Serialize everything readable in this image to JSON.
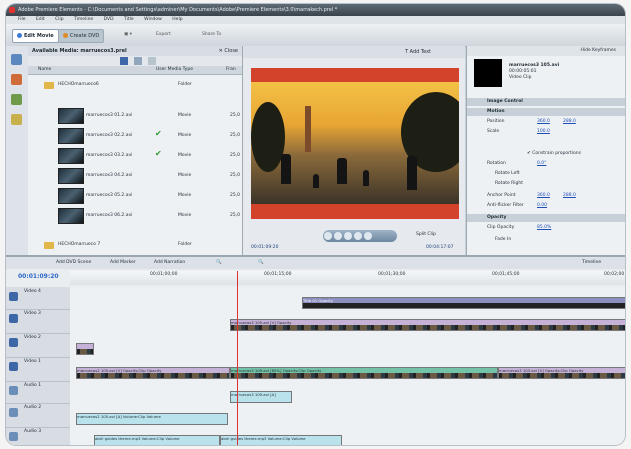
{
  "window": {
    "title": "Adobe Premiere Elements - C:\\Documents and Settings\\adminer\\My Documents\\Adobe\\Premiere Elements\\3.0\\marrakech.prel *"
  },
  "menu": [
    "File",
    "Edit",
    "Clip",
    "Timeline",
    "DVD",
    "Title",
    "Window",
    "Help"
  ],
  "toolbar": {
    "edit_movie": "Edit Movie",
    "create": "Create DVD",
    "export": "Export",
    "share": "Share To"
  },
  "media_panel": {
    "title": "Available Media: marruecos3.prel",
    "close": "Close",
    "columns": {
      "name": "Name",
      "type": "User Media Type",
      "frame": "Fran"
    },
    "items": [
      {
        "name": "HECHOmarrueco6",
        "type": "Folder",
        "frame": "",
        "check": false,
        "folder": true
      },
      {
        "name": "marruecos3 01.2.avi",
        "type": "Movie",
        "frame": "25,0",
        "check": false,
        "folder": false
      },
      {
        "name": "marruecos3 02.2.avi",
        "type": "Movie",
        "frame": "25,0",
        "check": true,
        "folder": false
      },
      {
        "name": "marruecos3 03.2.avi",
        "type": "Movie",
        "frame": "25,0",
        "check": true,
        "folder": false
      },
      {
        "name": "marruecos3 04.2.avi",
        "type": "Movie",
        "frame": "25,0",
        "check": false,
        "folder": false
      },
      {
        "name": "marruecos3 05.2.avi",
        "type": "Movie",
        "frame": "25,0",
        "check": false,
        "folder": false
      },
      {
        "name": "marruecos3 06.2.avi",
        "type": "Movie",
        "frame": "25,0",
        "check": false,
        "folder": false
      },
      {
        "name": "HECHOmarrueco 7",
        "type": "Folder",
        "frame": "",
        "check": false,
        "folder": true
      }
    ]
  },
  "monitor": {
    "add_text": "Add Text",
    "timecode_left": "00:01:09:20",
    "timecode_right": "00:04:17:07",
    "split_clip": "Split Clip"
  },
  "properties": {
    "header": "Hide Keyframes",
    "clip_name": "marruecos3 105.avi",
    "clip_time": "00:00:05:01",
    "clip_kind": "Video Clip",
    "sections": {
      "image_control": "Image Control",
      "motion": "Motion",
      "opacity": "Opacity"
    },
    "rows": {
      "position": {
        "label": "Position",
        "v1": "360.0",
        "v2": "288.0"
      },
      "scale": {
        "label": "Scale",
        "v1": "100.0"
      },
      "constrain": "Constrain proportions",
      "rotation": {
        "label": "Rotation",
        "v1": "0.0°"
      },
      "rotate_left": "Rotate Left",
      "rotate_right": "Rotate Right",
      "anchor": {
        "label": "Anchor Point",
        "v1": "360.0",
        "v2": "288.0"
      },
      "antiflicker": {
        "label": "Anti-flicker Filter",
        "v1": "0.00"
      },
      "clip_opacity": {
        "label": "Clip Opacity",
        "v1": "85.0%"
      },
      "fade_in": "Fade In"
    }
  },
  "timeline": {
    "timecode": "00:01:09:20",
    "tools": {
      "add_dvd": "Add DVD Scene",
      "add_marker": "Add Marker",
      "add_narration": "Add Narration",
      "view": "Timeline"
    },
    "ruler": [
      "00;01;00;00",
      "00;01;15;00",
      "00;01;30;00",
      "00;01;45;00",
      "00;02;00"
    ],
    "tracks": [
      {
        "name": "Video 4"
      },
      {
        "name": "Video 3"
      },
      {
        "name": "Video 2"
      },
      {
        "name": "Video 1"
      },
      {
        "name": "Audio 1"
      },
      {
        "name": "Audio 2"
      },
      {
        "name": "Audio 3"
      }
    ],
    "clip_labels": {
      "title": "Title 01 Opacity",
      "v3": "marruecos3 105.avi [V] Opacity",
      "v1a": "marruecos2 105.avi [V] Opacity:Clip Opacity",
      "v1b": "marruecos3 109.avi [85%] Opacity:Clip Opacity",
      "v1c": "marruecos3 103.avi [V] Opacity:Clip Opacity",
      "a1": "marruecos3 109.avi [A]",
      "a2": "marruecos2 105.avi [A] Volume:Clip Volume",
      "a3a": "abril guides theme.mp3 Volume:Clip Volume",
      "a3b": "abril guides theme.mp3 Volume:Clip Volume"
    }
  }
}
